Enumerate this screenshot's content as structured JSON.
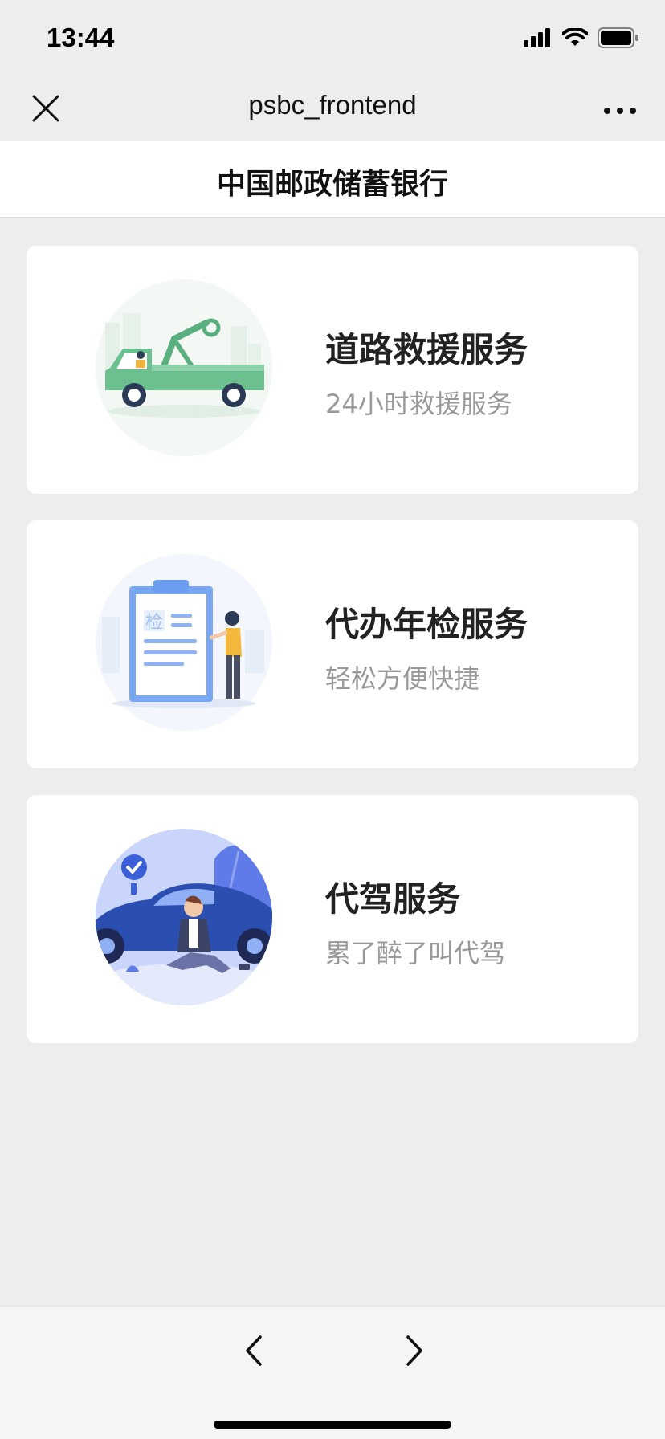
{
  "status_bar": {
    "time": "13:44",
    "icons": [
      "signal-icon",
      "wifi-icon",
      "battery-icon"
    ]
  },
  "nav_bar": {
    "title": "psbc_frontend",
    "icons": [
      "close-icon",
      "more-icon"
    ]
  },
  "page": {
    "title": "中国邮政储蓄银行"
  },
  "services": [
    {
      "title": "道路救援服务",
      "subtitle": "24小时救援服务",
      "icon": "tow-truck-illustration"
    },
    {
      "title": "代办年检服务",
      "subtitle": "轻松方便快捷",
      "icon": "inspection-clipboard-illustration"
    },
    {
      "title": "代驾服务",
      "subtitle": "累了醉了叫代驾",
      "icon": "designated-driver-illustration"
    }
  ],
  "bottom_bar": {
    "icons": [
      "back-arrow-icon",
      "forward-arrow-icon"
    ]
  },
  "colors": {
    "background": "#ededf0",
    "card": "#ffffff",
    "title_text": "#222222",
    "subtitle_text": "#999999",
    "truck_green": "#6cc08f",
    "clipboard_blue": "#6a9cf0",
    "car_blue": "#2a4fb0"
  }
}
